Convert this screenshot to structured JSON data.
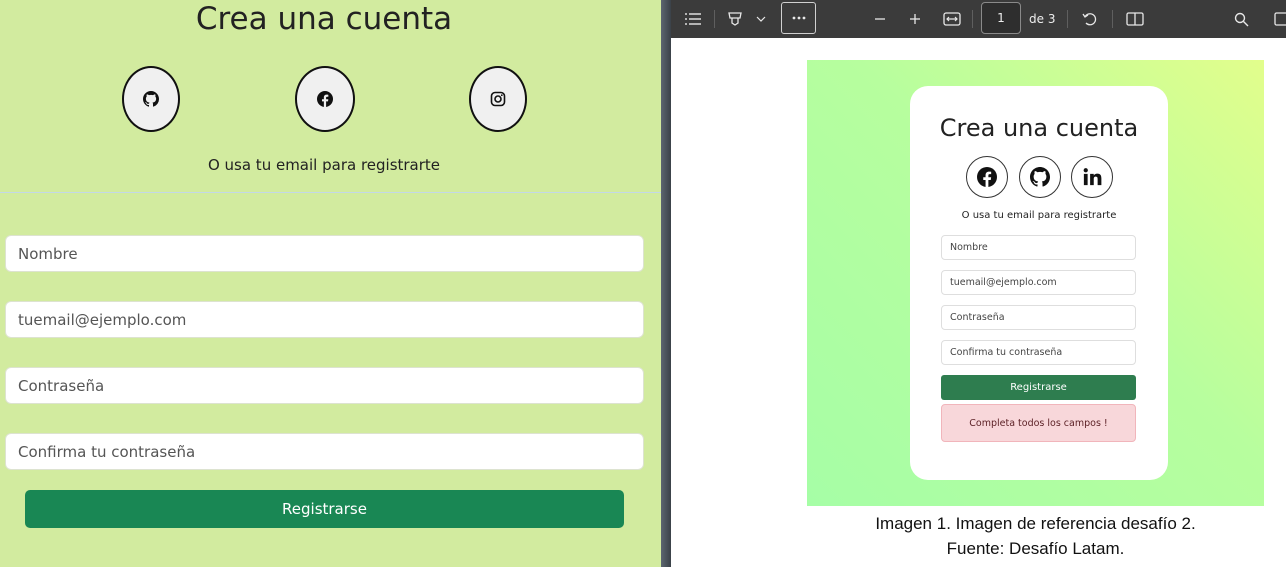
{
  "form": {
    "title": "Crea una cuenta",
    "social": [
      "github-icon",
      "facebook-icon",
      "instagram-icon"
    ],
    "subtitle": "O usa tu email para registrarte",
    "fields": {
      "name_placeholder": "Nombre",
      "email_placeholder": "tuemail@ejemplo.com",
      "password_placeholder": "Contraseña",
      "confirm_placeholder": "Confirma tu contraseña"
    },
    "register_label": "Registrarse"
  },
  "pdf_toolbar": {
    "page_current": "1",
    "page_total": "de 3",
    "icons": [
      "outline-icon",
      "highlight-icon",
      "chevron-down-icon",
      "more-icon",
      "zoom-out-icon",
      "zoom-in-icon",
      "fit-width-icon",
      "rotate-icon",
      "two-page-icon",
      "search-icon"
    ]
  },
  "pdf_page": {
    "reference": {
      "title": "Crea una cuenta",
      "social": [
        "facebook-icon",
        "github-icon",
        "linkedin-icon"
      ],
      "subtitle": "O usa tu email para registrarte",
      "fields": [
        "Nombre",
        "tuemail@ejemplo.com",
        "Contraseña",
        "Confirma tu contraseña"
      ],
      "register_label": "Registrarse",
      "alert_text": "Completa todos los campos !"
    },
    "caption_line1": "Imagen 1. Imagen de referencia desafío 2.",
    "caption_line2": "Fuente: Desafío Latam."
  },
  "colors": {
    "left_background": "#d2eb9f",
    "register_green": "#198754",
    "toolbar": "#3b3b3b",
    "alert_bg": "#f8d7da"
  }
}
